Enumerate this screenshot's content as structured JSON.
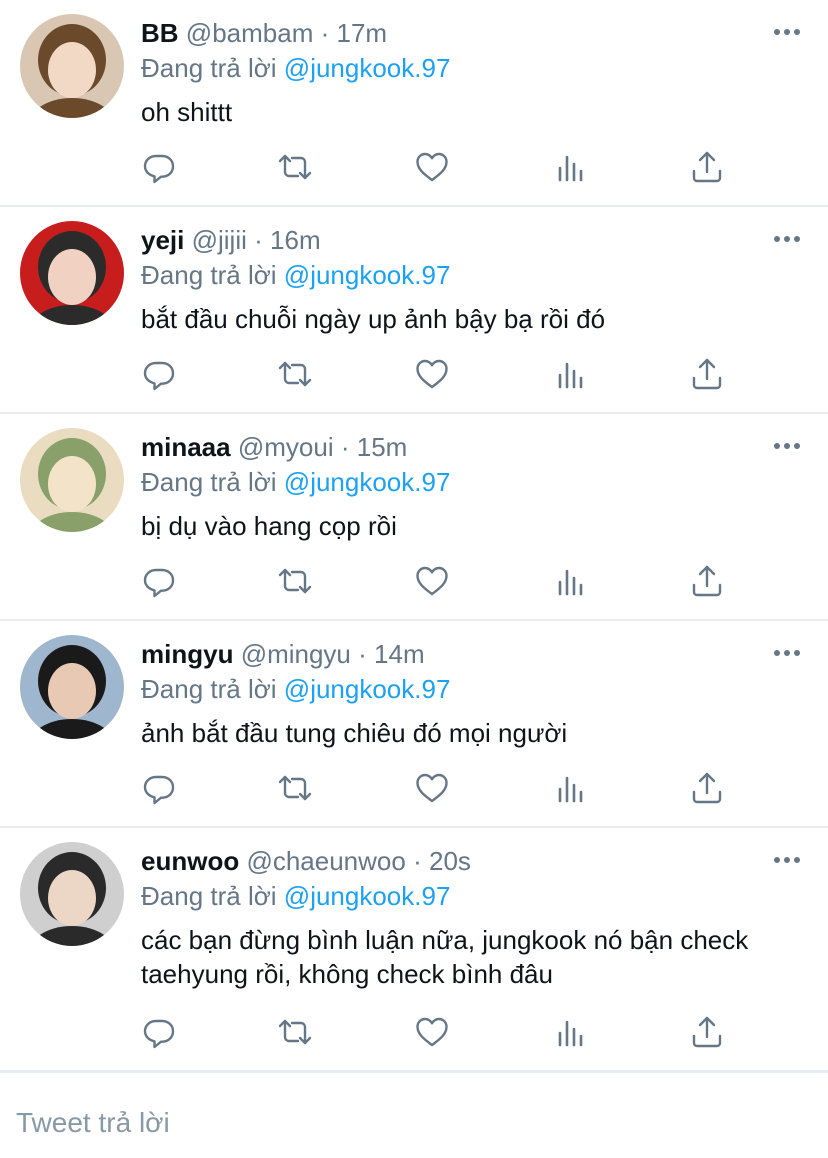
{
  "tweets": [
    {
      "name": "BB",
      "handle": "@bambam",
      "separator": "·",
      "time": "17m",
      "reply_prefix": "Đang trả lời",
      "reply_to": "@jungkook.97",
      "text": "oh shittt",
      "avatar_colors": [
        "#d9c7b3",
        "#6b4a2b",
        "#f1d9c6"
      ]
    },
    {
      "name": "yeji",
      "handle": "@jijii",
      "separator": "·",
      "time": "16m",
      "reply_prefix": "Đang trả lời",
      "reply_to": "@jungkook.97",
      "text": "bắt đầu chuỗi ngày up ảnh bậy bạ rồi đó",
      "avatar_colors": [
        "#c81d1d",
        "#2b2b2b",
        "#f1d2c2"
      ]
    },
    {
      "name": "minaaa",
      "handle": "@myoui",
      "separator": "·",
      "time": "15m",
      "reply_prefix": "Đang trả lời",
      "reply_to": "@jungkook.97",
      "text": "bị dụ vào hang cọp rồi",
      "avatar_colors": [
        "#e9dcc1",
        "#8aa06a",
        "#f3e3c8"
      ]
    },
    {
      "name": "mingyu",
      "handle": "@mingyu",
      "separator": "·",
      "time": "14m",
      "reply_prefix": "Đang trả lời",
      "reply_to": "@jungkook.97",
      "text": "ảnh bắt đầu tung chiêu đó mọi người",
      "avatar_colors": [
        "#9fb6cf",
        "#1a1a1a",
        "#e8c9b4"
      ]
    },
    {
      "name": "eunwoo",
      "handle": "@chaeunwoo",
      "separator": "·",
      "time": "20s",
      "reply_prefix": "Đang trả lời",
      "reply_to": "@jungkook.97",
      "text": "các bạn đừng bình luận nữa, jungkook nó bận check taehyung rồi, không check bình đâu",
      "avatar_colors": [
        "#cfcfcf",
        "#2a2a2a",
        "#ecd6c6"
      ]
    }
  ],
  "icons": {
    "more": "more-icon",
    "reply": "reply-icon",
    "retweet": "retweet-icon",
    "like": "heart-icon",
    "stats": "stats-icon",
    "share": "share-icon"
  },
  "colors": {
    "icon": "#657786",
    "mention": "#1da1f2",
    "secondary": "#657786",
    "divider": "#e6ecf0"
  },
  "compose": {
    "placeholder": "Tweet trả lời"
  }
}
